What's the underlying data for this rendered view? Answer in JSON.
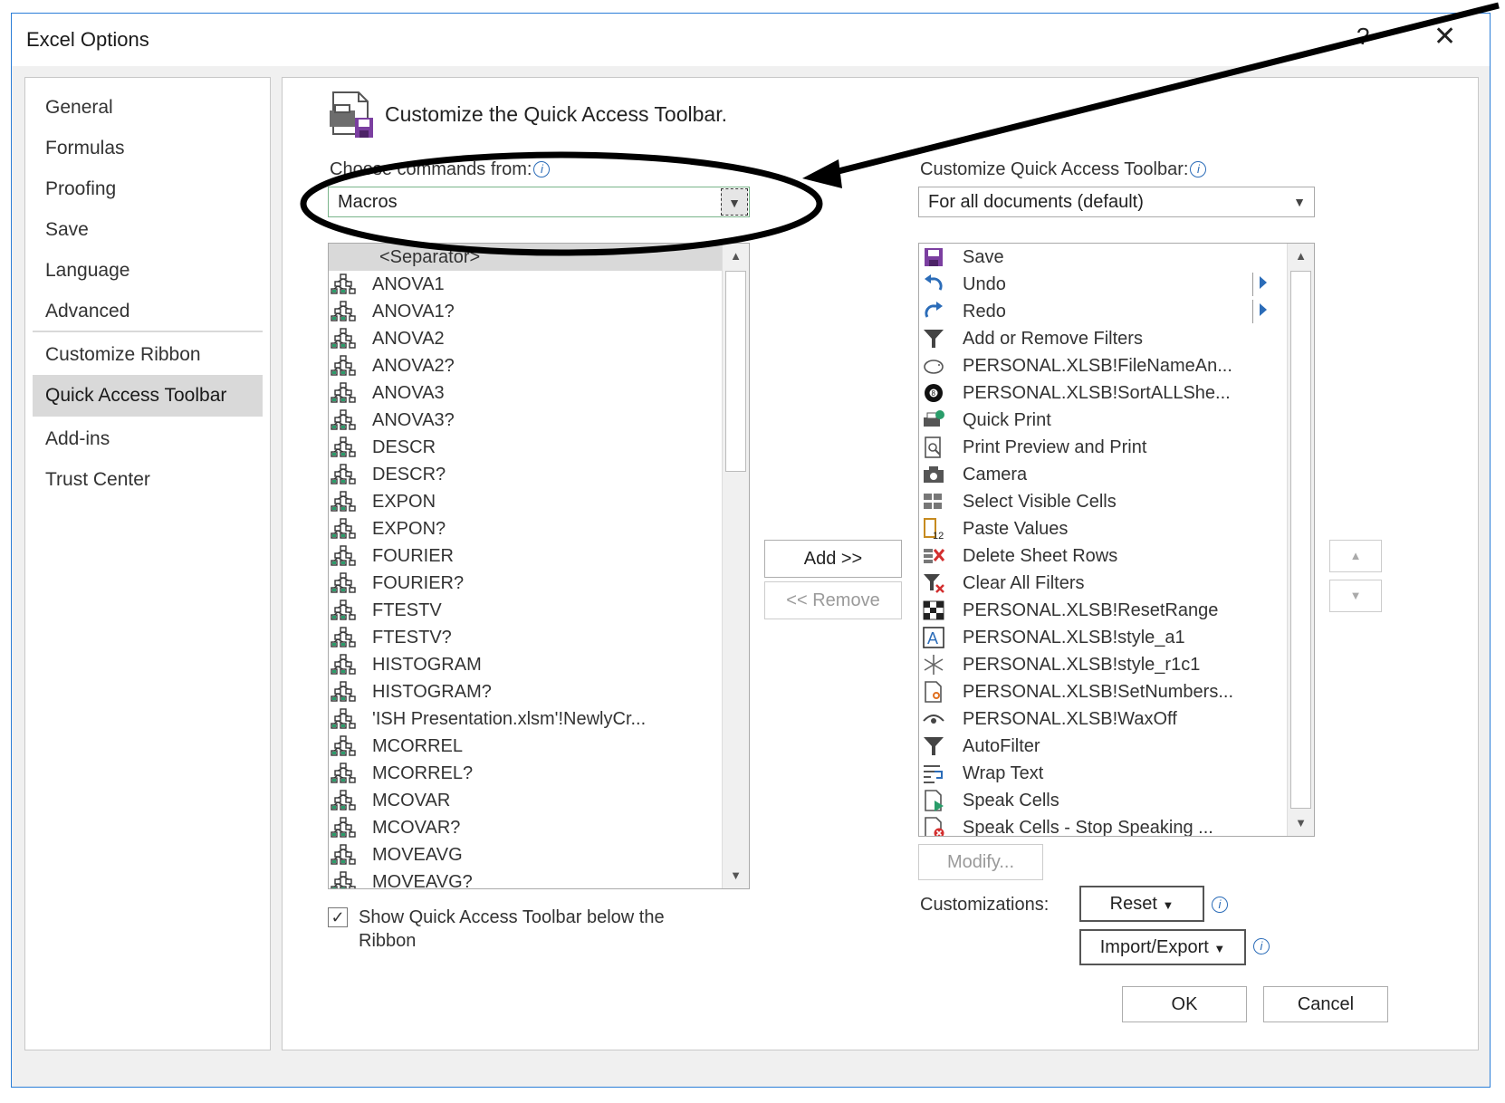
{
  "window": {
    "title": "Excel Options",
    "help_label": "?",
    "close_label": "✕"
  },
  "nav": {
    "items": [
      "General",
      "Formulas",
      "Proofing",
      "Save",
      "Language",
      "Advanced",
      "Customize Ribbon",
      "Quick Access Toolbar",
      "Add-ins",
      "Trust Center"
    ],
    "selected": "Quick Access Toolbar"
  },
  "main": {
    "heading": "Customize the Quick Access Toolbar.",
    "choose_label": "Choose commands from:",
    "choose_value": "Macros",
    "customize_label": "Customize Quick Access Toolbar:",
    "customize_value": "For all documents (default)",
    "commands": [
      "<Separator>",
      "ANOVA1",
      "ANOVA1?",
      "ANOVA2",
      "ANOVA2?",
      "ANOVA3",
      "ANOVA3?",
      "DESCR",
      "DESCR?",
      "EXPON",
      "EXPON?",
      "FOURIER",
      "FOURIER?",
      "FTESTV",
      "FTESTV?",
      "HISTOGRAM",
      "HISTOGRAM?",
      "'ISH Presentation.xlsm'!NewlyCr...",
      "MCORREL",
      "MCORREL?",
      "MCOVAR",
      "MCOVAR?",
      "MOVEAVG",
      "MOVEAVG?"
    ],
    "toolbar_items": [
      {
        "label": "Save",
        "icon": "save-icon",
        "submenu": false
      },
      {
        "label": "Undo",
        "icon": "undo-icon",
        "submenu": true
      },
      {
        "label": "Redo",
        "icon": "redo-icon",
        "submenu": true
      },
      {
        "label": "Add or Remove Filters",
        "icon": "filter-icon",
        "submenu": false
      },
      {
        "label": "PERSONAL.XLSB!FileNameAn...",
        "icon": "piggy-bank-icon",
        "submenu": false
      },
      {
        "label": "PERSONAL.XLSB!SortALLShe...",
        "icon": "eight-ball-icon",
        "submenu": false
      },
      {
        "label": "Quick Print",
        "icon": "quick-print-icon",
        "submenu": false
      },
      {
        "label": "Print Preview and Print",
        "icon": "print-preview-icon",
        "submenu": false
      },
      {
        "label": "Camera",
        "icon": "camera-icon",
        "submenu": false
      },
      {
        "label": "Select Visible Cells",
        "icon": "visible-cells-icon",
        "submenu": false
      },
      {
        "label": "Paste Values",
        "icon": "paste-values-icon",
        "submenu": false
      },
      {
        "label": "Delete Sheet Rows",
        "icon": "delete-rows-icon",
        "submenu": false
      },
      {
        "label": "Clear All Filters",
        "icon": "clear-filters-icon",
        "submenu": false
      },
      {
        "label": "PERSONAL.XLSB!ResetRange",
        "icon": "checkerboard-icon",
        "submenu": false
      },
      {
        "label": "PERSONAL.XLSB!style_a1",
        "icon": "letter-a-icon",
        "submenu": false
      },
      {
        "label": "PERSONAL.XLSB!style_r1c1",
        "icon": "snowflake-icon",
        "submenu": false
      },
      {
        "label": "PERSONAL.XLSB!SetNumbers...",
        "icon": "document-search-icon",
        "submenu": false
      },
      {
        "label": "PERSONAL.XLSB!WaxOff",
        "icon": "eye-icon",
        "submenu": false
      },
      {
        "label": "AutoFilter",
        "icon": "filter-icon",
        "submenu": false
      },
      {
        "label": "Wrap Text",
        "icon": "wrap-text-icon",
        "submenu": false
      },
      {
        "label": "Speak Cells",
        "icon": "speak-cells-icon",
        "submenu": false
      },
      {
        "label": "Speak Cells - Stop Speaking ...",
        "icon": "stop-speaking-icon",
        "submenu": false
      }
    ],
    "add_label": "Add >>",
    "remove_label": "<< Remove",
    "modify_label": "Modify...",
    "customizations_label": "Customizations:",
    "reset_label": "Reset",
    "import_export_label": "Import/Export",
    "show_below_label": "Show Quick Access Toolbar below the Ribbon",
    "show_below_checked": true
  },
  "footer": {
    "ok_label": "OK",
    "cancel_label": "Cancel"
  },
  "colors": {
    "accent": "#2b7ed8",
    "selected_nav": "#d9d9d9",
    "info_blue": "#2b6cb8",
    "annotation": "#000000"
  }
}
